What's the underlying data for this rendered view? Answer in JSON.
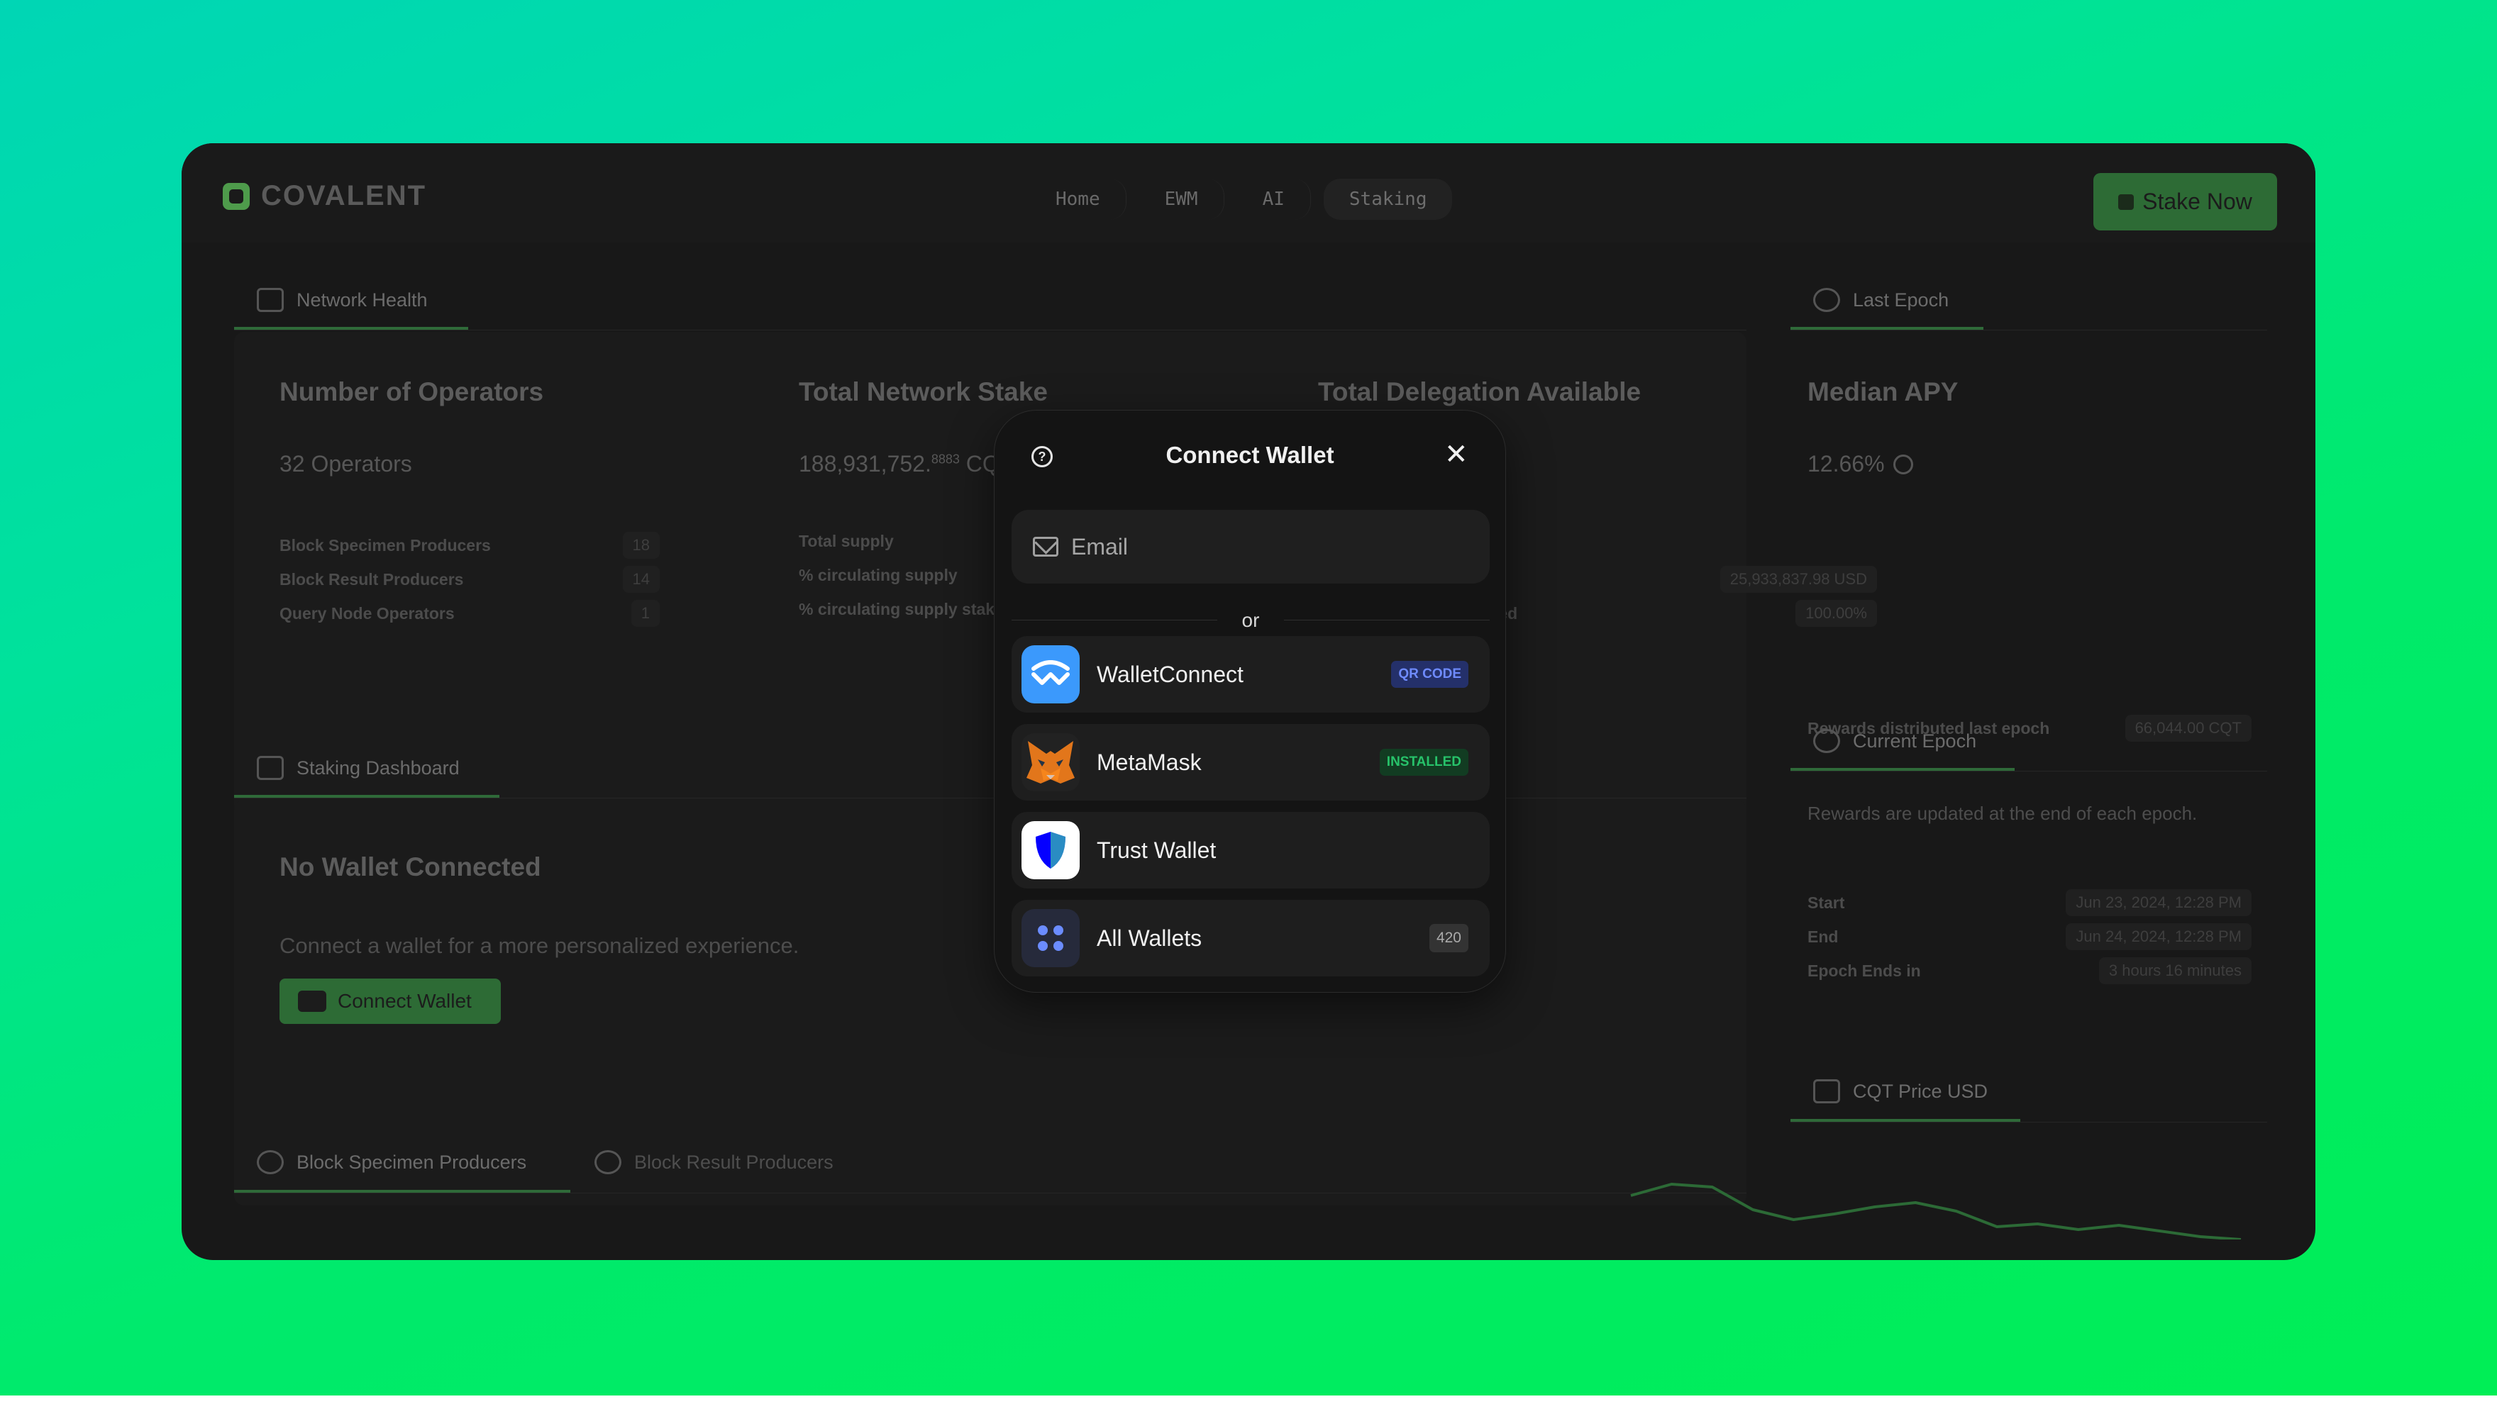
{
  "app": {
    "logo_text": "COVALENT"
  },
  "nav": {
    "items": [
      "Home",
      "EWM",
      "AI",
      "Staking"
    ],
    "active": "Staking"
  },
  "header": {
    "stake_button": "Stake Now"
  },
  "network_health": {
    "tab_label": "Network Health",
    "operators": {
      "title": "Number of Operators",
      "value": "32 Operators",
      "rows": [
        {
          "label": "Block Specimen Producers",
          "value": "18"
        },
        {
          "label": "Block Result Producers",
          "value": "14"
        },
        {
          "label": "Query Node Operators",
          "value": "1"
        }
      ]
    },
    "stake": {
      "title": "Total Network Stake",
      "value": "188,931,752.",
      "value_decimals": "8883",
      "value_suffix": " CQT",
      "rows": [
        {
          "label": "Total supply"
        },
        {
          "label": "% circulating supply"
        },
        {
          "label": "% circulating supply staked"
        }
      ]
    },
    "delegation": {
      "title": "Total Delegation Available",
      "rows": [
        {
          "label": "",
          "value": "25,933,837.98 USD"
        },
        {
          "label": "led",
          "value": "100.00%"
        }
      ]
    }
  },
  "last_epoch": {
    "tab_label": "Last Epoch",
    "title": "Median APY",
    "value": "12.66%",
    "rewards_label": "Rewards distributed last epoch",
    "rewards_value": "66,044.00 CQT"
  },
  "current_epoch": {
    "tab_label": "Current Epoch",
    "note": "Rewards are updated at the end of each epoch.",
    "rows": [
      {
        "label": "Start",
        "value": "Jun 23, 2024, 12:28 PM"
      },
      {
        "label": "End",
        "value": "Jun 24, 2024, 12:28 PM"
      },
      {
        "label": "Epoch Ends in",
        "value": "3 hours 16 minutes"
      }
    ]
  },
  "price": {
    "tab_label": "CQT Price USD",
    "sparkline": [
      0.62,
      0.78,
      0.74,
      0.42,
      0.28,
      0.36,
      0.46,
      0.52,
      0.4,
      0.18,
      0.22,
      0.14,
      0.2,
      0.12,
      0.04,
      0.0
    ]
  },
  "staking_dashboard": {
    "tab_label": "Staking Dashboard",
    "title": "No Wallet Connected",
    "subtitle": "Connect a wallet for a more personalized experience.",
    "button": "Connect Wallet"
  },
  "producer_tabs": [
    "Block Specimen Producers",
    "Block Result Producers"
  ],
  "modal": {
    "title": "Connect Wallet",
    "help_glyph": "?",
    "close_glyph": "✕",
    "email_placeholder": "Email",
    "or_text": "or",
    "wallets": [
      {
        "name": "WalletConnect",
        "tag": "QR CODE",
        "icon": "walletconnect-icon"
      },
      {
        "name": "MetaMask",
        "tag": "INSTALLED",
        "icon": "metamask-fox-icon"
      },
      {
        "name": "Trust Wallet",
        "tag": "",
        "icon": "trust-wallet-shield-icon"
      },
      {
        "name": "All Wallets",
        "tag": "420",
        "icon": "all-wallets-grid-icon"
      }
    ]
  },
  "colors": {
    "accent": "#2d6b35",
    "modal_bg": "#141414",
    "page_bg": "#181818"
  }
}
